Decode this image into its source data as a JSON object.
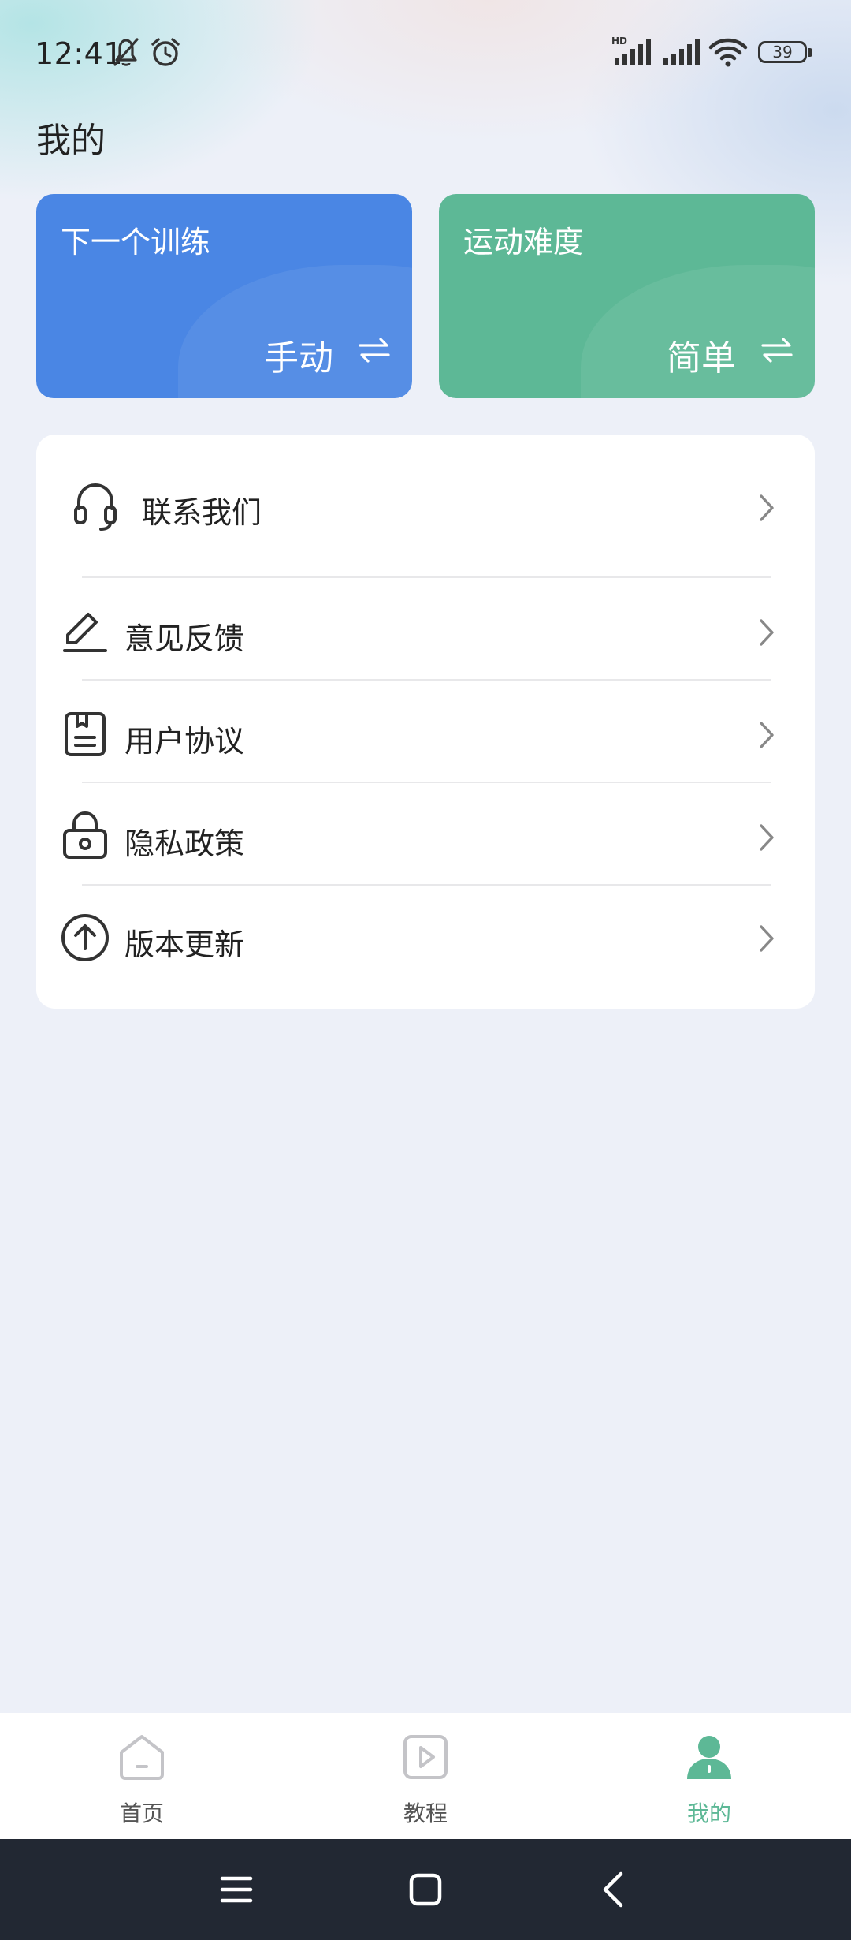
{
  "status_bar": {
    "time": "12:41",
    "battery": "39",
    "icons": [
      "bell-off-icon",
      "alarm-icon",
      "hd-signal-icon",
      "signal-icon",
      "wifi-icon",
      "battery-icon"
    ]
  },
  "page": {
    "title": "我的"
  },
  "cards": [
    {
      "title": "下一个训练",
      "value": "手动",
      "color": "#4a86e4",
      "icon": "swap-icon"
    },
    {
      "title": "运动难度",
      "value": "简单",
      "color": "#5db896",
      "icon": "swap-icon"
    }
  ],
  "menu": {
    "items": [
      {
        "label": "联系我们",
        "icon": "headset-icon"
      },
      {
        "label": "意见反馈",
        "icon": "pencil-icon"
      },
      {
        "label": "用户协议",
        "icon": "document-icon"
      },
      {
        "label": "隐私政策",
        "icon": "lock-icon"
      },
      {
        "label": "版本更新",
        "icon": "upload-icon"
      }
    ]
  },
  "bottom_nav": {
    "items": [
      {
        "label": "首页",
        "icon": "home-icon",
        "active": false
      },
      {
        "label": "教程",
        "icon": "play-icon",
        "active": false
      },
      {
        "label": "我的",
        "icon": "user-icon",
        "active": true
      }
    ],
    "active_color": "#5db896"
  },
  "system_nav": {
    "buttons": [
      "menu-icon",
      "home-square-icon",
      "back-icon"
    ]
  }
}
